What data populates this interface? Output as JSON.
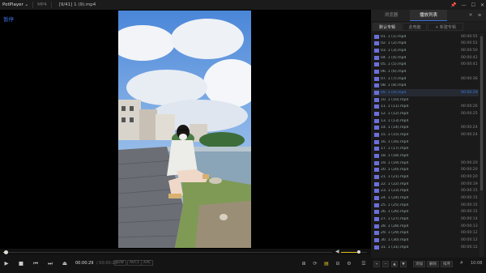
{
  "titlebar": {
    "app": "PotPlayer ⌄",
    "format": "MP4",
    "file": "[9/41] 1 (9).mp4",
    "buttons": [
      "📌",
      "—",
      "☐",
      "✕"
    ]
  },
  "video": {
    "status_label": "暂停"
  },
  "progress": {
    "position_fraction": 0.007,
    "volume_fraction": 0.7
  },
  "controls": {
    "play_icon": "▶",
    "stop_icon": "■",
    "prev_icon": "⏮",
    "next_icon": "⏭",
    "open_icon": "⏏",
    "time_current": "00:00:29",
    "time_total": "/ 00:00:29",
    "badges": [
      "S/W",
      "AVC1",
      "AAC"
    ],
    "right_icons": [
      "⊞",
      "⟳",
      "▤",
      "⊟",
      "⚙",
      "☰"
    ]
  },
  "panel": {
    "tabs": [
      "浏览器",
      "播放列表"
    ],
    "close_icon": "✕",
    "menu_icon": "≡",
    "subtabs": [
      "默认专辑",
      "此电脑",
      "+ 新建专辑"
    ],
    "items": [
      {
        "name": "01. 1 (1).mp4",
        "duration": "00:00:55"
      },
      {
        "name": "02. 1 (2).mp4",
        "duration": "00:00:52"
      },
      {
        "name": "03. 1 (3).mp4",
        "duration": "00:00:50"
      },
      {
        "name": "04. 1 (4).mp4",
        "duration": "00:00:42"
      },
      {
        "name": "05. 1 (5).mp4",
        "duration": "00:00:41"
      },
      {
        "name": "06. 1 (6).mp4",
        "duration": ""
      },
      {
        "name": "07. 1 (7).mp4",
        "duration": "00:00:36"
      },
      {
        "name": "08. 1 (8).mp4",
        "duration": ""
      },
      {
        "name": "09. 1 (9).mp4",
        "duration": "00:00:29"
      },
      {
        "name": "10. 1 (10).mp4",
        "duration": ""
      },
      {
        "name": "11. 1 (11).mp4",
        "duration": "00:00:26"
      },
      {
        "name": "12. 1 (12).mp4",
        "duration": "00:00:25"
      },
      {
        "name": "13. 1 (13).mp4",
        "duration": ""
      },
      {
        "name": "14. 1 (14).mp4",
        "duration": "00:00:24"
      },
      {
        "name": "15. 1 (15).mp4",
        "duration": "00:00:24"
      },
      {
        "name": "16. 1 (16).mp4",
        "duration": ""
      },
      {
        "name": "17. 1 (17).mp4",
        "duration": ""
      },
      {
        "name": "18. 1 (18).mp4",
        "duration": ""
      },
      {
        "name": "19. 1 (19).mp4",
        "duration": "00:00:20"
      },
      {
        "name": "20. 1 (20).mp4",
        "duration": "00:00:20"
      },
      {
        "name": "21. 1 (21).mp4",
        "duration": "00:00:20"
      },
      {
        "name": "22. 1 (22).mp4",
        "duration": "00:00:19"
      },
      {
        "name": "23. 1 (23).mp4",
        "duration": "00:00:15"
      },
      {
        "name": "24. 1 (24).mp4",
        "duration": "00:00:15"
      },
      {
        "name": "25. 1 (25).mp4",
        "duration": "00:00:15"
      },
      {
        "name": "26. 1 (26).mp4",
        "duration": "00:00:15"
      },
      {
        "name": "27. 1 (27).mp4",
        "duration": "00:00:14"
      },
      {
        "name": "28. 1 (28).mp4",
        "duration": "00:00:13"
      },
      {
        "name": "29. 1 (29).mp4",
        "duration": "00:00:12"
      },
      {
        "name": "30. 1 (30).mp4",
        "duration": "00:00:12"
      },
      {
        "name": "31. 1 (31).mp4",
        "duration": "00:00:12"
      }
    ],
    "current_index": 8,
    "bottom_buttons": [
      "+",
      "−",
      "▲",
      "▼",
      "添加",
      "删除",
      "排序"
    ],
    "search_icon": "⌕",
    "count": "10:08"
  },
  "colors": {
    "accent": "#3a7be0",
    "progress": "#e0c020",
    "file_icon": "#6b6fd8"
  }
}
